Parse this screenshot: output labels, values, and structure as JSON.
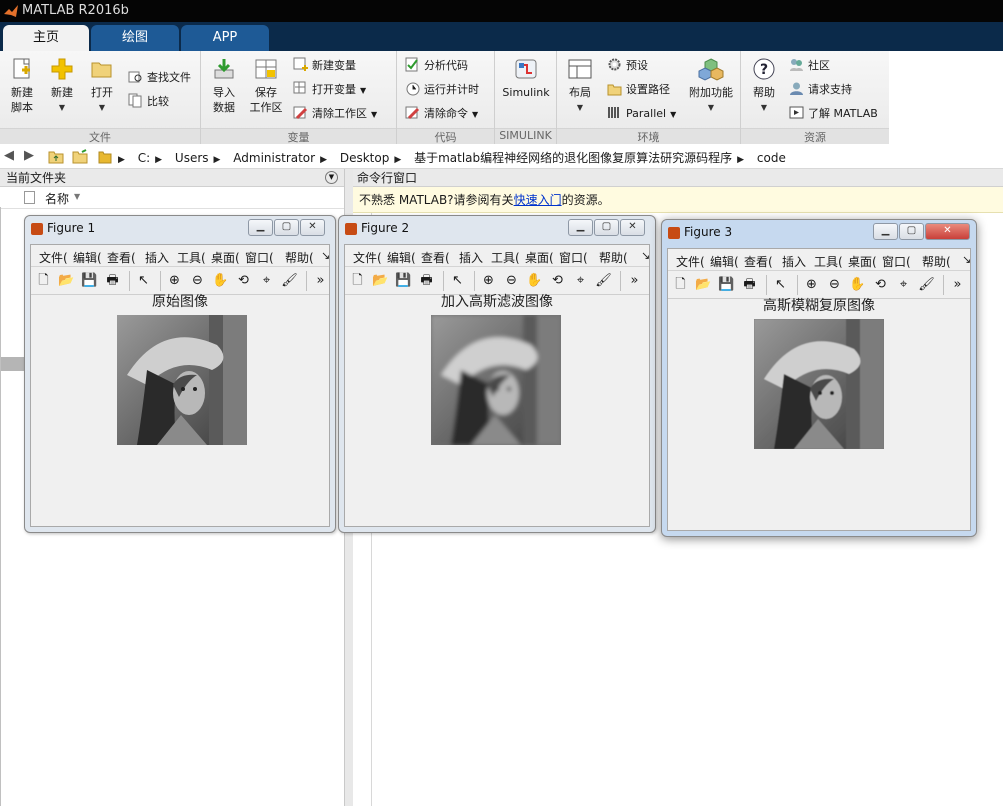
{
  "app": {
    "title": "MATLAB R2016b"
  },
  "tabs": [
    {
      "label": "主页"
    },
    {
      "label": "绘图"
    },
    {
      "label": "APP"
    }
  ],
  "ribbon": {
    "file": {
      "label": "文件",
      "new_script": "新建\n脚本",
      "new": "新建",
      "open": "打开",
      "find_files": "查找文件",
      "compare": "比较"
    },
    "variable": {
      "label": "变量",
      "import_data": "导入\n数据",
      "save_workspace": "保存\n工作区",
      "new_variable": "新建变量",
      "open_variable": "打开变量",
      "clear_workspace": "清除工作区"
    },
    "code": {
      "label": "代码",
      "analyze_code": "分析代码",
      "run_and_time": "运行并计时",
      "clear_commands": "清除命令"
    },
    "simulink": {
      "label": "SIMULINK",
      "simulink": "Simulink"
    },
    "environment": {
      "label": "环境",
      "layout": "布局",
      "preferences": "预设",
      "set_path": "设置路径",
      "parallel": "Parallel",
      "add_ons": "附加功能"
    },
    "resources": {
      "label": "资源",
      "help": "帮助",
      "community": "社区",
      "request_support": "请求支持",
      "learn_matlab": "了解 MATLAB"
    }
  },
  "address": {
    "path": [
      "C:",
      "Users",
      "Administrator",
      "Desktop",
      "基于matlab编程神经网络的退化图像复原算法研究源码程序",
      "code"
    ]
  },
  "current_folder": {
    "title": "当前文件夹",
    "col_name": "名称"
  },
  "command_window": {
    "title": "命令行窗口",
    "info_prefix": "不熟悉 MATLAB?请参阅有关",
    "info_link": "快速入门",
    "info_suffix": "的资源。"
  },
  "figure_menu": [
    "文件(",
    "编辑(",
    "查看(",
    "插入",
    "工具(",
    "桌面(",
    "窗口(",
    "帮助("
  ],
  "figures": [
    {
      "title": "Figure 1",
      "axes_title": "原始图像",
      "blur": 0
    },
    {
      "title": "Figure 2",
      "axes_title": "加入高斯滤波图像",
      "blur": 2.2
    },
    {
      "title": "Figure 3",
      "axes_title": "高斯模糊复原图像",
      "blur": 0.4
    }
  ],
  "colors": {
    "tab_bar": "#0b2a4a",
    "tab_active": "#f2f2f2",
    "tab_inactive": "#1e5a96",
    "info_bg": "#fffbe0",
    "close_btn": "#c9403a"
  },
  "icons": [
    "matlab-logo-icon",
    "new-script-icon",
    "new-icon",
    "open-folder-icon",
    "find-files-icon",
    "compare-icon",
    "import-data-icon",
    "save-workspace-icon",
    "new-variable-icon",
    "open-variable-icon",
    "clear-workspace-icon",
    "analyze-code-icon",
    "run-and-time-icon",
    "clear-commands-icon",
    "simulink-icon",
    "layout-icon",
    "preferences-icon",
    "set-path-icon",
    "parallel-icon",
    "add-ons-icon",
    "help-icon",
    "community-icon",
    "request-support-icon",
    "learn-matlab-icon",
    "back-arrow-icon",
    "forward-arrow-icon",
    "folder-up-icon",
    "browse-folder-icon"
  ]
}
